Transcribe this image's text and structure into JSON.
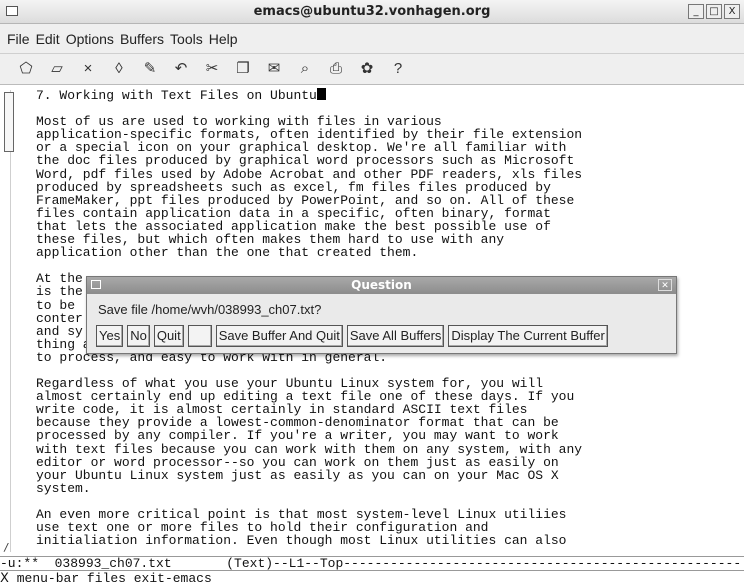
{
  "window": {
    "title": "emacs@ubuntu32.vonhagen.org",
    "buttons": [
      "_",
      "□",
      "X"
    ]
  },
  "menubar": {
    "items": [
      "File",
      "Edit",
      "Options",
      "Buffers",
      "Tools",
      "Help"
    ]
  },
  "toolbar": {
    "icons": [
      {
        "name": "new-file-icon",
        "glyph": "⬠"
      },
      {
        "name": "open-file-icon",
        "glyph": "▱"
      },
      {
        "name": "close-buffer-icon",
        "glyph": "×"
      },
      {
        "name": "save-icon",
        "glyph": "◊"
      },
      {
        "name": "save-as-icon",
        "glyph": "✎"
      },
      {
        "name": "undo-icon",
        "glyph": "↶"
      },
      {
        "name": "cut-icon",
        "glyph": "✂"
      },
      {
        "name": "copy-icon",
        "glyph": "❐"
      },
      {
        "name": "paste-icon",
        "glyph": "✉"
      },
      {
        "name": "search-icon",
        "glyph": "⌕"
      },
      {
        "name": "print-icon",
        "glyph": "⎙"
      },
      {
        "name": "preferences-icon",
        "glyph": "✿"
      },
      {
        "name": "help-icon",
        "glyph": "?"
      }
    ]
  },
  "buffer": {
    "heading": "7. Working with Text Files on Ubuntu",
    "paragraph1": "Most of us are used to working with files in various\napplication-specific formats, often identified by their file extension\nor a special icon on your graphical desktop. We're all familiar with\nthe doc files produced by graphical word processors such as Microsoft\nWord, pdf files used by Adobe Acrobat and other PDF readers, xls files\nproduced by spreadsheets such as excel, fm files files produced by\nFrameMaker, ppt files produced by PowerPoint, and so on. All of these\nfiles contain application data in a specific, often binary, format\nthat lets the associated application make the best possible use of\nthese files, but which often makes them hard to use with any\napplication other than the one that created them.",
    "paragraph2": "At the\nis the\nto be\nconter\nand sy\nthing about these types of files is that they are easy to read, easy\nto process, and easy to work with in general.",
    "paragraph3": "Regardless of what you use your Ubuntu Linux system for, you will\nalmost certainly end up editing a text file one of these days. If you\nwrite code, it is almost certainly in standard ASCII text files\nbecause they provide a lowest-common-denominator format that can be\nprocessed by any compiler. If you're a writer, you may want to work\nwith text files because you can work with them on any system, with any\neditor or word processor--so you can work on them just as easily on\nyour Ubuntu Linux system just as easily as you can on your Mac OS X\nsystem.",
    "paragraph4": "An even more critical point is that most system-level Linux utiliies\nuse text one or more files to hold their configuration and\ninitialiation information. Even though most Linux utilities can also"
  },
  "modeline": {
    "text": "-u:**  038993_ch07.txt       (Text)--L1--Top---------------------------------------------------"
  },
  "minibuffer": {
    "text": "menu-bar files exit-emacs"
  },
  "dialog": {
    "title": "Question",
    "message": "Save file /home/wvh/038993_ch07.txt?",
    "buttons": {
      "yes": "Yes",
      "no": "No",
      "quit": "Quit",
      "blank": "",
      "save_quit": "Save Buffer And Quit",
      "save_all": "Save All Buffers",
      "display": "Display The Current Buffer"
    }
  }
}
